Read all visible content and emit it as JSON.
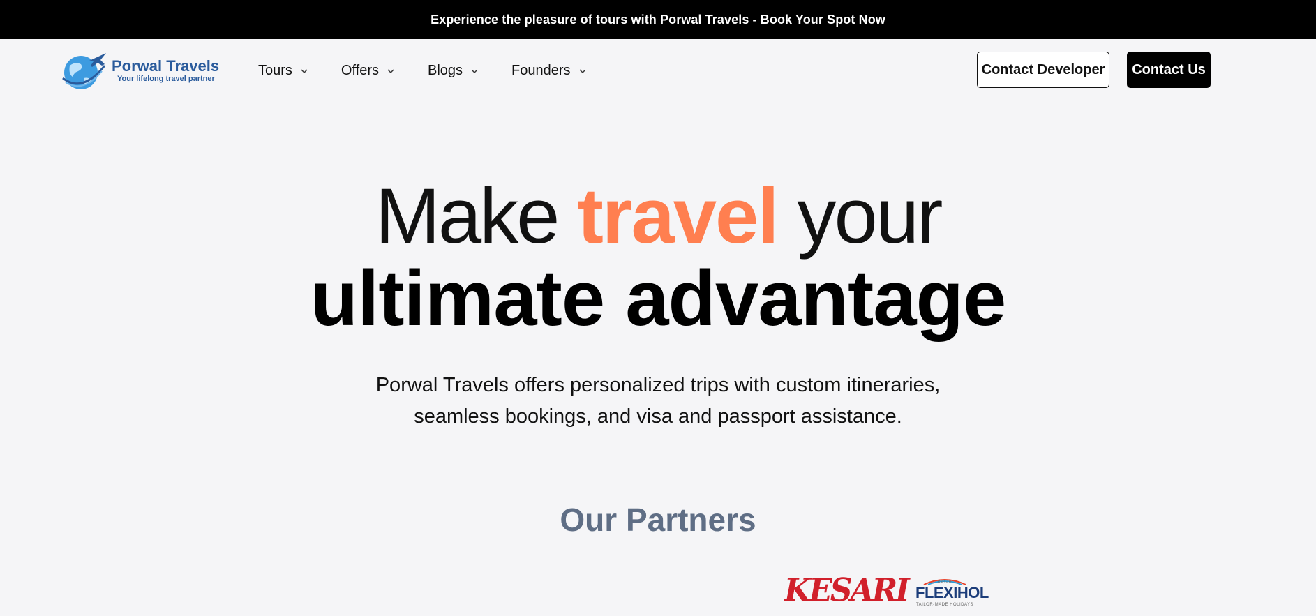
{
  "announcement": {
    "text": "Experience the pleasure of tours with Porwal Travels - Book Your Spot Now"
  },
  "brand": {
    "name": "Porwal Travels",
    "tagline": "Your lifelong travel partner",
    "color": "#2a5b9c"
  },
  "nav": {
    "items": [
      {
        "label": "Tours",
        "icon": "chevron-down-icon"
      },
      {
        "label": "Offers",
        "icon": "chevron-down-icon"
      },
      {
        "label": "Blogs",
        "icon": "chevron-down-icon"
      },
      {
        "label": "Founders",
        "icon": "chevron-down-icon"
      }
    ],
    "contact_developer_label": "Contact Developer",
    "contact_us_label": "Contact Us"
  },
  "hero": {
    "line1_before": "Make ",
    "line1_accent": "travel",
    "line1_after": " your",
    "line2": "ultimate advantage",
    "accent_color": "#ff7f50",
    "subtitle_line1": "Porwal Travels offers personalized trips with custom itineraries,",
    "subtitle_line2": "seamless bookings, and visa and passport assistance."
  },
  "partners": {
    "title": "Our Partners",
    "logos": [
      {
        "name": "KESARI",
        "color": "#d1202b"
      },
      {
        "name": "FLEXIHOL",
        "small_top": "Kesari",
        "small_bottom": "TAILOR-MADE HOLIDAYS",
        "color": "#1c3d7a"
      }
    ]
  }
}
